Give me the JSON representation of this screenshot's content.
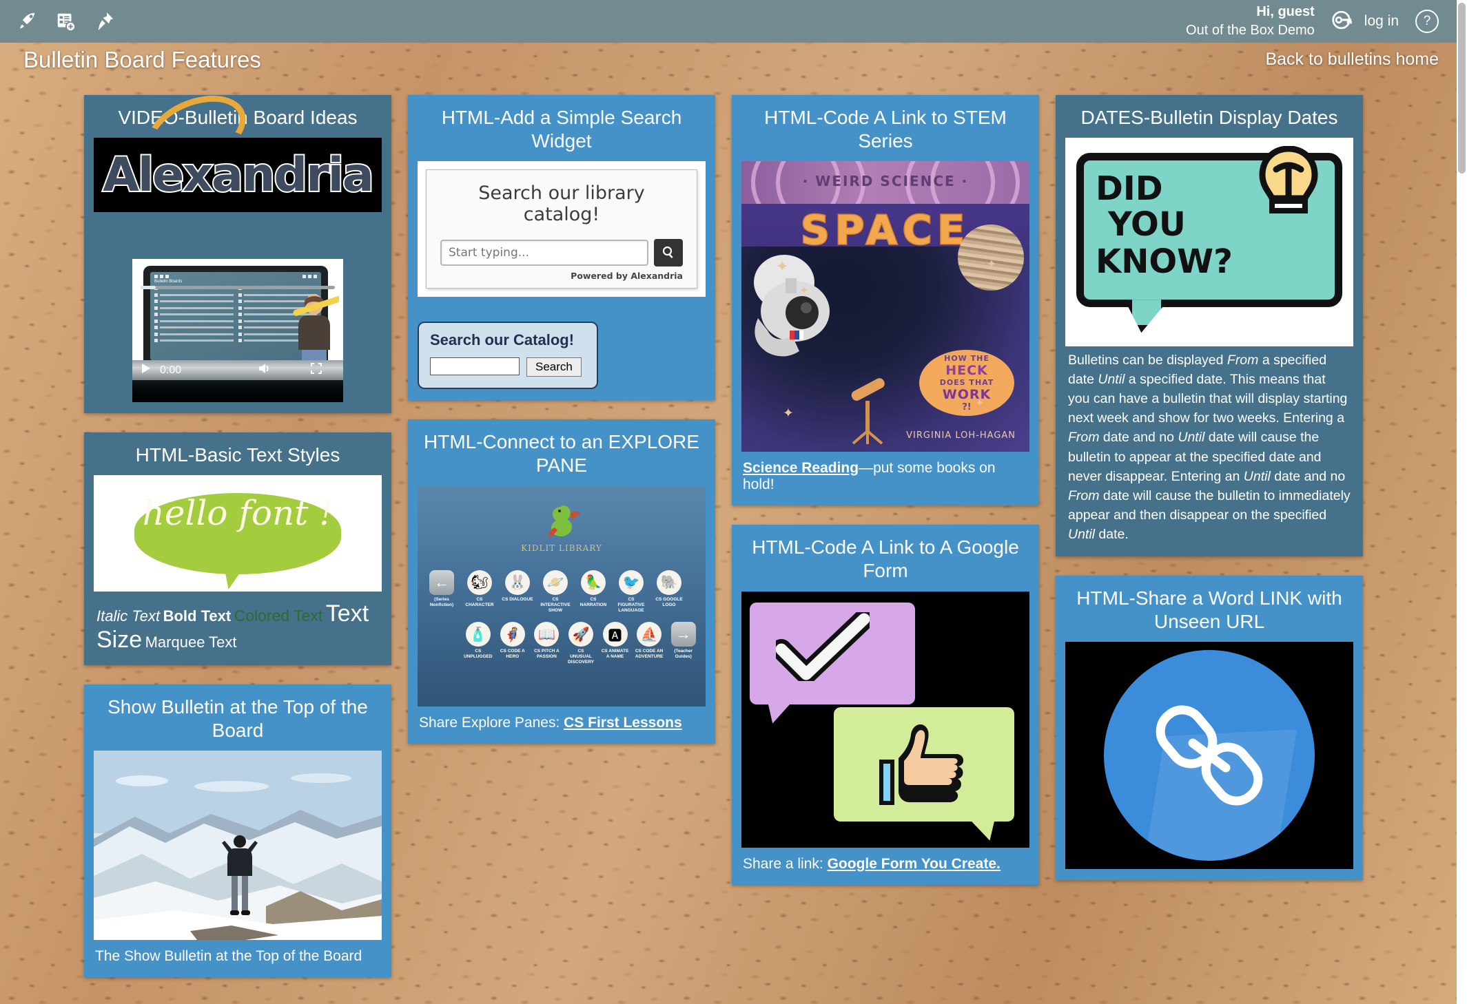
{
  "topbar": {
    "icons": [
      {
        "name": "rocket-icon",
        "label": "rocket"
      },
      {
        "name": "add-bulletin-icon",
        "label": "add bulletin"
      },
      {
        "name": "pushpin-icon",
        "label": "pushpin"
      }
    ],
    "greeting": "Hi, guest",
    "organization": "Out of the Box Demo",
    "login_label": "log in",
    "help_label": "?",
    "background_color": "#718b91"
  },
  "page": {
    "title": "Bulletin Board Features",
    "back_link": "Back to bulletins home"
  },
  "cards": {
    "video_bulletin": {
      "title": "VIDEO-Bulletin Board Ideas",
      "logo_text": "Alexandria",
      "video_time": "0:00",
      "screen_title": "Bulletin Boards",
      "accent": "#45718a"
    },
    "search_widget": {
      "title": "HTML-Add a Simple Search Widget",
      "widget_heading": "Search our library catalog!",
      "input_value": "",
      "input_placeholder": "Start typing...",
      "powered_by": "Powered by Alexandria",
      "form_heading": "Search our Catalog!",
      "form_input_value": "",
      "form_button": "Search",
      "accent": "#4592c8"
    },
    "stem_link": {
      "title": "HTML-Code A Link to STEM Series",
      "cover_series": "· WEIRD SCIENCE ·",
      "cover_title": "SPACE",
      "cover_badge_l1": "HOW THE",
      "cover_badge_l2": "HECK",
      "cover_badge_l3": "DOES THAT",
      "cover_badge_l4": "WORK",
      "cover_badge_l5": "?!",
      "cover_author": "VIRGINIA LOH-HAGAN",
      "caption_link": "Science Reading",
      "caption_rest": "—put some books on hold!",
      "accent": "#4592c8"
    },
    "display_dates": {
      "title": "DATES-Bulletin Display Dates",
      "image_line1": "DID",
      "image_line2": "YOU",
      "image_line3": "KNOW?",
      "body": "Bulletins can be displayed From a specified date Until a specified date. This means that you can have a bulletin that will display starting next week and show for two weeks. Entering a From date and no Until date will cause the bulletin to appear at the specified date and never disappear. Entering an Until date and no From date will cause the bulletin to immediately appear and then disappear on the specified Until date.",
      "accent": "#45718a"
    },
    "text_styles": {
      "title": "HTML-Basic Text Styles",
      "image_text": "hello font !",
      "italic_text": "Italic Text",
      "bold_text": "Bold Text",
      "colored_text": "Colored Text",
      "size_text": "Text Size",
      "marquee_text": "Marquee Text",
      "colored_hex": "#2c6b31",
      "accent": "#45718a"
    },
    "show_top": {
      "title": "Show Bulletin at the Top of the Board",
      "caption": "The Show Bulletin at the Top of the Board",
      "accent": "#4592c8"
    },
    "explore_pane": {
      "title": "HTML-Connect to an EXPLORE PANE",
      "pane_logo": "KIDLIT LIBRARY",
      "row1": [
        {
          "label": "(Series Nonfiction)",
          "icon": "back-arrow-icon"
        },
        {
          "label": "CS CHARACTER",
          "icon": "squirrel-icon"
        },
        {
          "label": "CS DIALOGUE",
          "icon": "rabbit-icon"
        },
        {
          "label": "CS INTERACTIVE SHOW",
          "icon": "planet-icon"
        },
        {
          "label": "CS NARRATION",
          "icon": "parrot-icon"
        },
        {
          "label": "CS FIGURATIVE LANGUAGE",
          "icon": "bird-icon"
        },
        {
          "label": "CS GOOGLE LOGO",
          "icon": "elephant-icon"
        }
      ],
      "row2": [
        {
          "label": "CS UNPLUGGED",
          "icon": "bottle-icon"
        },
        {
          "label": "CS CODE A HERO",
          "icon": "hero-icon"
        },
        {
          "label": "CS PITCH A PASSION",
          "icon": "book-icon"
        },
        {
          "label": "CS UNUSUAL DISCOVERY",
          "icon": "rocket-icon"
        },
        {
          "label": "CS ANIMATE A NAME",
          "icon": "letter-a-icon"
        },
        {
          "label": "CS CODE AN ADVENTURE",
          "icon": "sailboat-icon"
        },
        {
          "label": "(Teacher Guides)",
          "icon": "forward-arrow-icon"
        }
      ],
      "caption_prefix": "Share Explore Panes: ",
      "caption_link": "CS First Lessons",
      "accent": "#4592c8"
    },
    "google_form": {
      "title": "HTML-Code A Link to A Google Form",
      "caption_prefix": "Share a link: ",
      "caption_link": "Google Form You Create.",
      "accent": "#4592c8"
    },
    "word_link": {
      "title": "HTML-Share a Word LINK with Unseen URL",
      "accent": "#4592c8"
    }
  }
}
